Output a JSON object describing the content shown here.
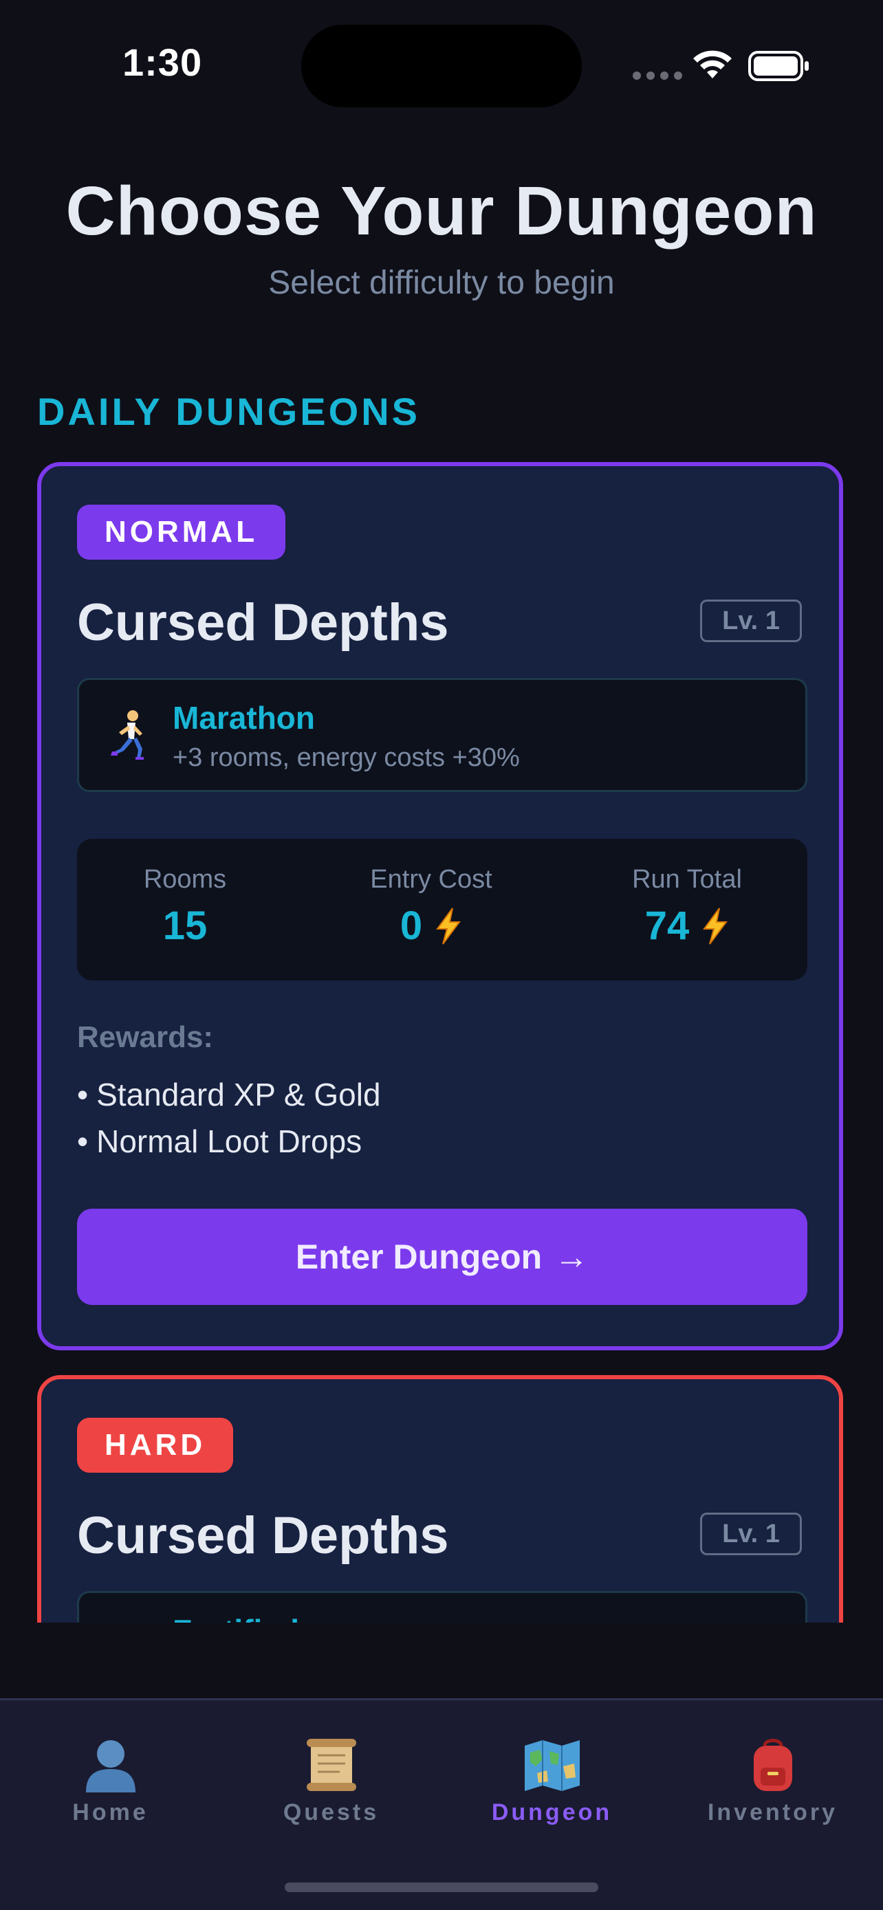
{
  "status_bar": {
    "time": "1:30"
  },
  "header": {
    "title": "Choose Your Dungeon",
    "subtitle": "Select difficulty to begin"
  },
  "section": {
    "heading": "DAILY DUNGEONS"
  },
  "cards": [
    {
      "difficulty": "NORMAL",
      "name": "Cursed Depths",
      "level": "Lv. 1",
      "modifier": {
        "icon": "runner-icon",
        "name": "Marathon",
        "description": "+3 rooms, energy costs +30%"
      },
      "stats": {
        "rooms_label": "Rooms",
        "rooms_value": "15",
        "entry_label": "Entry Cost",
        "entry_value": "0",
        "total_label": "Run Total",
        "total_value": "74"
      },
      "rewards_label": "Rewards:",
      "rewards": [
        "Standard XP & Gold",
        "Normal Loot Drops"
      ],
      "button_label": "Enter Dungeon",
      "button_arrow": "→"
    },
    {
      "difficulty": "HARD",
      "name": "Cursed Depths",
      "level": "Lv. 1",
      "modifier": {
        "icon": "shield-icon",
        "name": "Fortified",
        "description": ""
      }
    }
  ],
  "tabs": [
    {
      "label": "Home",
      "icon": "person-icon",
      "active": false
    },
    {
      "label": "Quests",
      "icon": "scroll-icon",
      "active": false
    },
    {
      "label": "Dungeon",
      "icon": "map-icon",
      "active": true
    },
    {
      "label": "Inventory",
      "icon": "backpack-icon",
      "active": false
    }
  ],
  "colors": {
    "background": "#0f0f18",
    "card": "#172140",
    "normal_accent": "#7c3aed",
    "hard_accent": "#ef4444",
    "cyan": "#19b6d6",
    "muted": "#7b8aa3"
  }
}
